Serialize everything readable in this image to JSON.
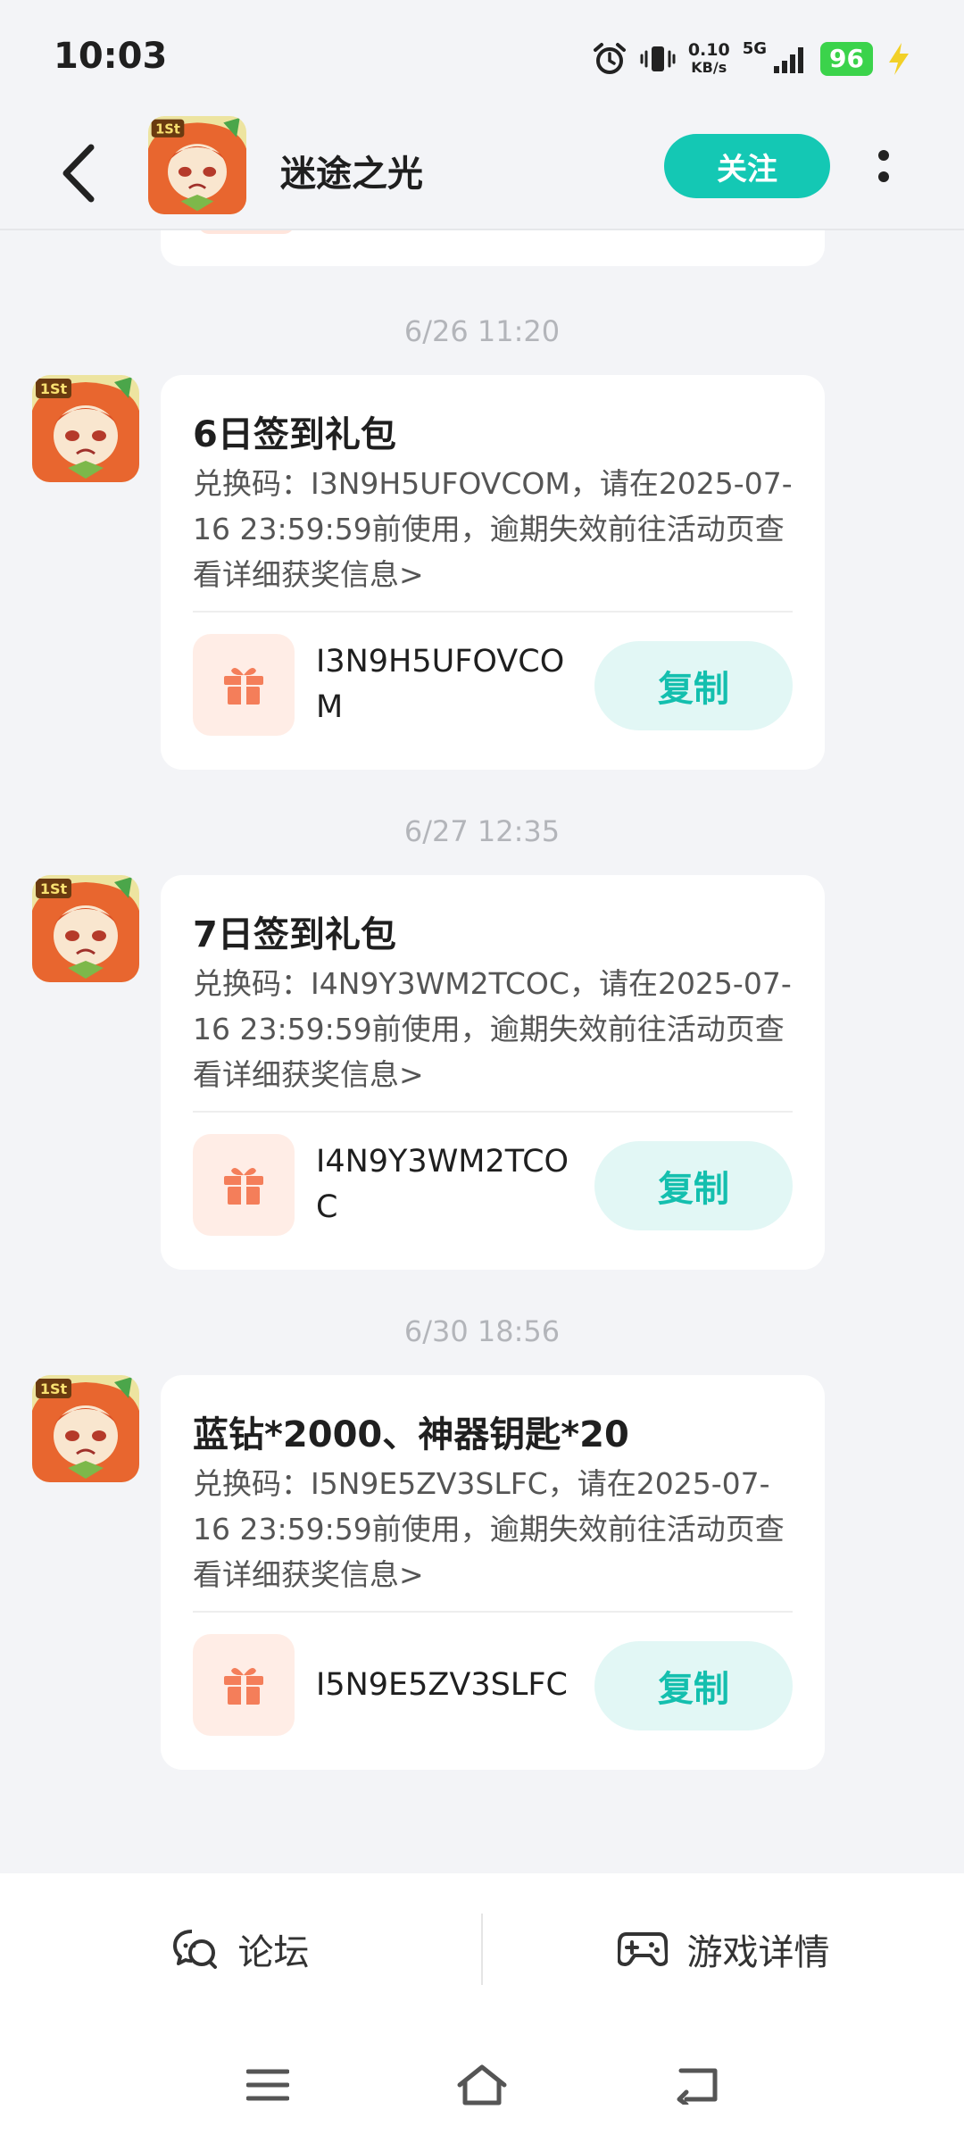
{
  "status": {
    "time": "10:03",
    "net_speed_value": "0.10",
    "net_speed_unit": "KB/s",
    "network": "5G",
    "battery": "96"
  },
  "header": {
    "title": "迷途之光",
    "follow_label": "关注"
  },
  "messages": [
    {
      "timestamp": "6/26  11:20",
      "title": "6日签到礼包",
      "desc": "兑换码：I3N9H5UFOVCOM，请在2025-07-16 23:59:59前使用，逾期失效前往活动页查看详细获奖信息>",
      "code": "I3N9H5UFOVCOM",
      "copy_label": "复制"
    },
    {
      "timestamp": "6/27  12:35",
      "title": "7日签到礼包",
      "desc": "兑换码：I4N9Y3WM2TCOC，请在2025-07-16 23:59:59前使用，逾期失效前往活动页查看详细获奖信息>",
      "code": "I4N9Y3WM2TCOC",
      "copy_label": "复制"
    },
    {
      "timestamp": "6/30  18:56",
      "title": "蓝钻*2000、神器钥匙*20",
      "desc": "兑换码：I5N9E5ZV3SLFC，请在2025-07-16 23:59:59前使用，逾期失效前往活动页查看详细获奖信息>",
      "code": "I5N9E5ZV3SLFC",
      "copy_label": "复制"
    }
  ],
  "bottom_tabs": {
    "forum": "论坛",
    "game_details": "游戏详情"
  },
  "colors": {
    "accent": "#14C8B4",
    "copy_bg": "#E2F7F5",
    "gift": "#F47E5A",
    "gift_bg": "#FFEDE6"
  },
  "icons": [
    "back-arrow-icon",
    "more-icon",
    "gift-icon",
    "forum-chat-icon",
    "gamepad-icon",
    "menu-icon",
    "home-icon",
    "back-icon"
  ]
}
